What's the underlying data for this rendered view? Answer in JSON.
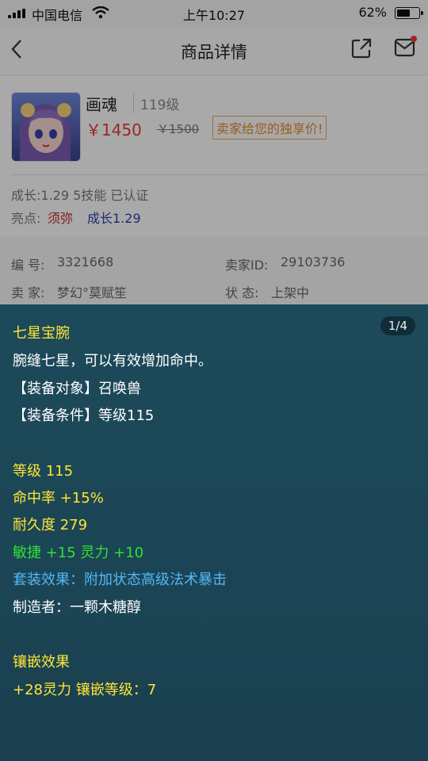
{
  "status_bar": {
    "carrier": "中国电信",
    "time": "上午10:27",
    "battery": "62%",
    "battery_level": 0.62
  },
  "nav": {
    "title": "商品详情",
    "back_icon": "chevron-left-icon",
    "share_icon": "share-icon",
    "message_icon": "mail-icon",
    "badge_color": "#e53935"
  },
  "item": {
    "name": "画魂",
    "level": "119级",
    "price": "￥1450",
    "original_price": "￥1500",
    "promo": "卖家给您的独享价!",
    "growth_line": "成长:1.29 5技能 已认证",
    "highlights_label": "亮点:",
    "highlights": [
      "须弥",
      "成长1.29"
    ]
  },
  "info": {
    "id_label": "编 号:",
    "id_value": "3321668",
    "seller_id_label": "卖家ID:",
    "seller_id_value": "29103736",
    "seller_label": "卖 家:",
    "seller_value": "梦幻°莫赋笙",
    "state_label": "状 态:",
    "state_value": "上架中"
  },
  "tooltip": {
    "pager": "1/4",
    "title": "七星宝腕",
    "desc": "腕缝七星，可以有效增加命中。",
    "target": "【装备对象】召唤兽",
    "condition": "【装备条件】等级115",
    "level": "等级 115",
    "hit_rate": "命中率 +15%",
    "durability": "耐久度 279",
    "bonus": "敏捷 +15 灵力 +10",
    "set_effect": "套装效果：附加状态高级法术暴击",
    "maker": "制造者：一颗木糖醇",
    "inlay_title": "镶嵌效果",
    "inlay_value": "+28灵力 镶嵌等级：7"
  }
}
